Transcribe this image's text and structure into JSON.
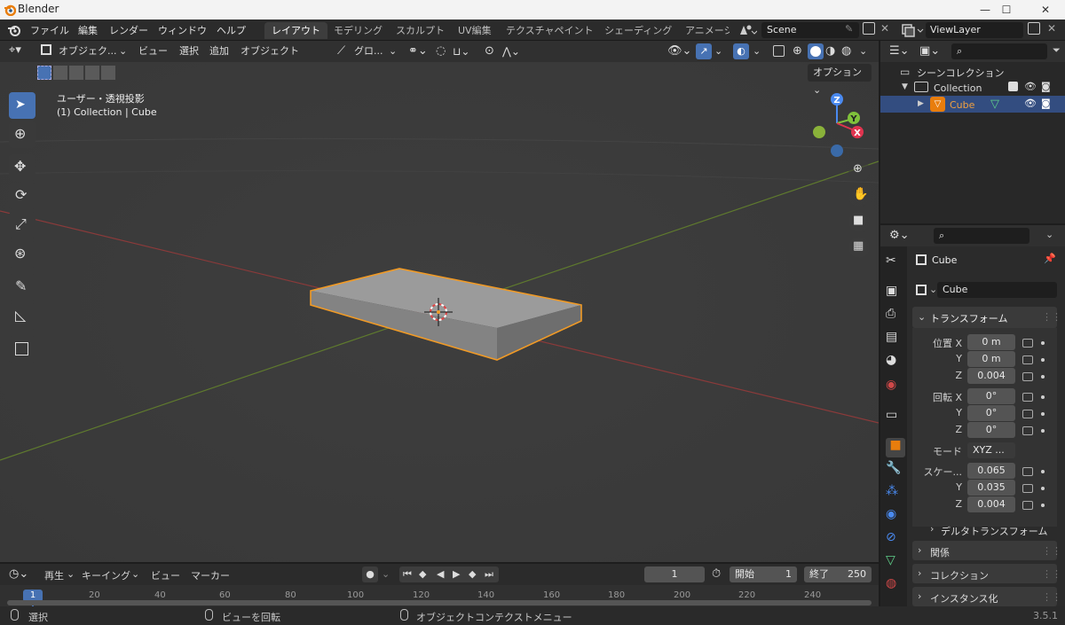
{
  "window": {
    "app_title": "Blender",
    "min": "—",
    "max": "☐",
    "close": "✕"
  },
  "topmenu": {
    "items": [
      "ファイル",
      "編集",
      "レンダー",
      "ウィンドウ",
      "ヘルプ"
    ]
  },
  "workspaces": {
    "tabs": [
      "レイアウト",
      "モデリング",
      "スカルプト",
      "UV編集",
      "テクスチャペイント",
      "シェーディング",
      "アニメーシ"
    ],
    "active": "レイアウト"
  },
  "scene": {
    "name": "Scene"
  },
  "viewlayer": {
    "name": "ViewLayer"
  },
  "viewport_header": {
    "mode": "オブジェク...",
    "menus": [
      "ビュー",
      "選択",
      "追加",
      "オブジェクト"
    ],
    "orientation": "グロ...",
    "options": "オプション"
  },
  "viewport": {
    "view_label": "ユーザー・透視投影",
    "collection_label": "(1) Collection | Cube"
  },
  "gizmo": {
    "z": "Z",
    "y": "Y",
    "x": "X"
  },
  "outliner": {
    "scene_collection": "シーンコレクション",
    "collection": "Collection",
    "object": "Cube"
  },
  "properties": {
    "object_name": "Cube",
    "data_name": "Cube",
    "transform_header": "トランスフォーム",
    "location_label": "位置 X",
    "rotation_label": "回転 X",
    "mode_label": "モード",
    "mode_value": "XYZ ...",
    "scale_label": "スケー...",
    "axis_y": "Y",
    "axis_z": "Z",
    "location": {
      "x": "0 m",
      "y": "0 m",
      "z": "0.004"
    },
    "rotation": {
      "x": "0°",
      "y": "0°",
      "z": "0°"
    },
    "scale": {
      "x": "0.065",
      "y": "0.035",
      "z": "0.004"
    },
    "delta": "デルタトランスフォーム",
    "relations": "関係",
    "collections": "コレクション",
    "instancing": "インスタンス化"
  },
  "timeline": {
    "menus": [
      "再生",
      "キーイング",
      "ビュー",
      "マーカー"
    ],
    "current_frame": "1",
    "start_label": "開始",
    "start": "1",
    "end_label": "終了",
    "end": "250",
    "ticks": [
      "1",
      "20",
      "40",
      "60",
      "80",
      "100",
      "120",
      "140",
      "160",
      "180",
      "200",
      "220",
      "240"
    ]
  },
  "statusbar": {
    "select": "選択",
    "rotate": "ビューを回転",
    "context": "オブジェクトコンテクストメニュー",
    "version": "3.5.1"
  }
}
